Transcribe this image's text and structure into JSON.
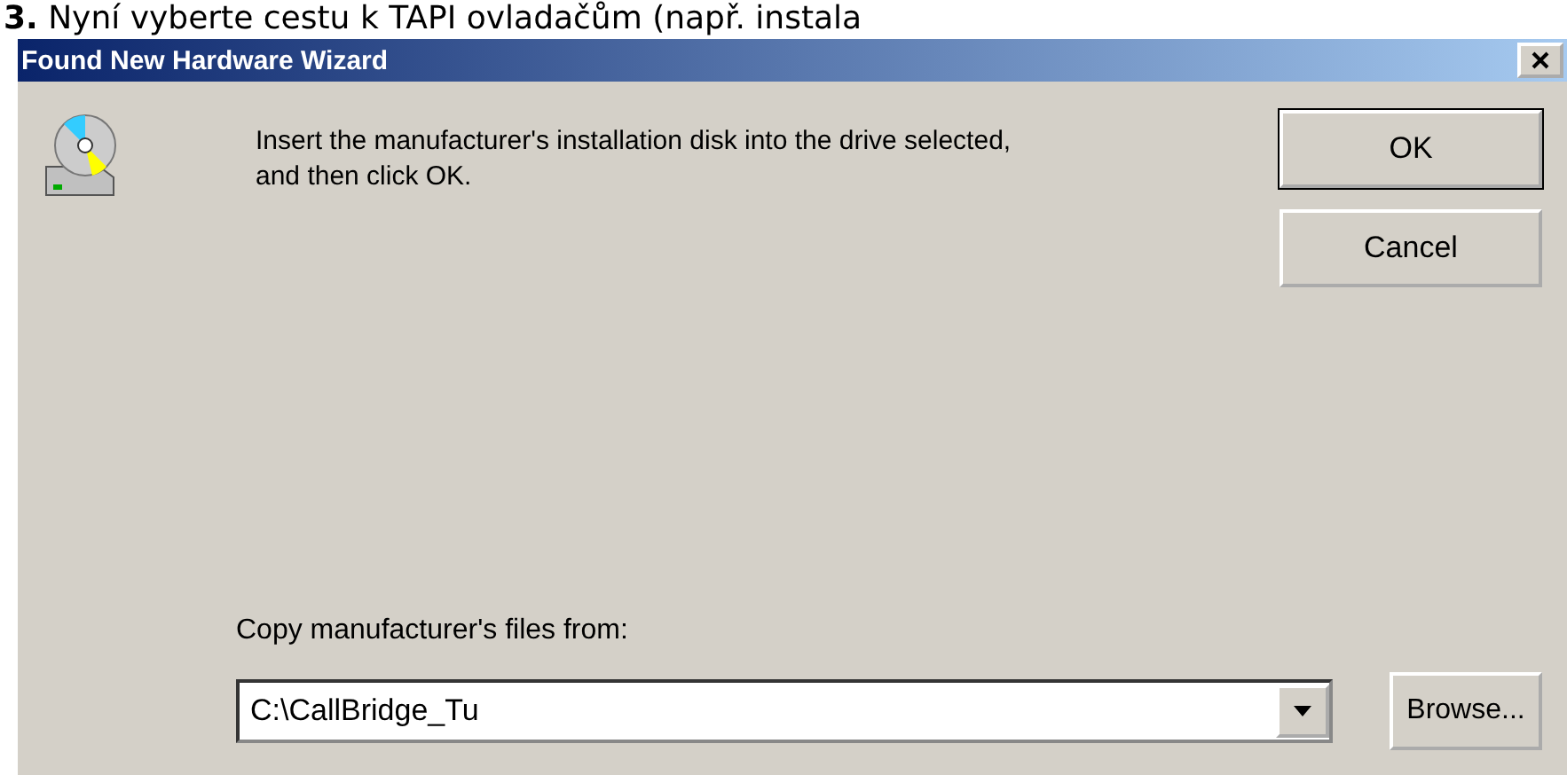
{
  "heading": "**3.** Nyní vyberte cestu k TAPI ovladačům (např. instala",
  "window": {
    "title": "Found New Hardware Wizard"
  },
  "message": "Insert the manufacturer's installation disk into the drive selected, and then click OK.",
  "buttons": [
    {
      "label": "OK",
      "default": true
    },
    {
      "label": "Cancel",
      "default": false
    }
  ],
  "copy_from": {
    "label": "Copy manufacturer's files from:",
    "value": "C:\\CallBridge_Tu"
  },
  "browse_button": "Browse..."
}
